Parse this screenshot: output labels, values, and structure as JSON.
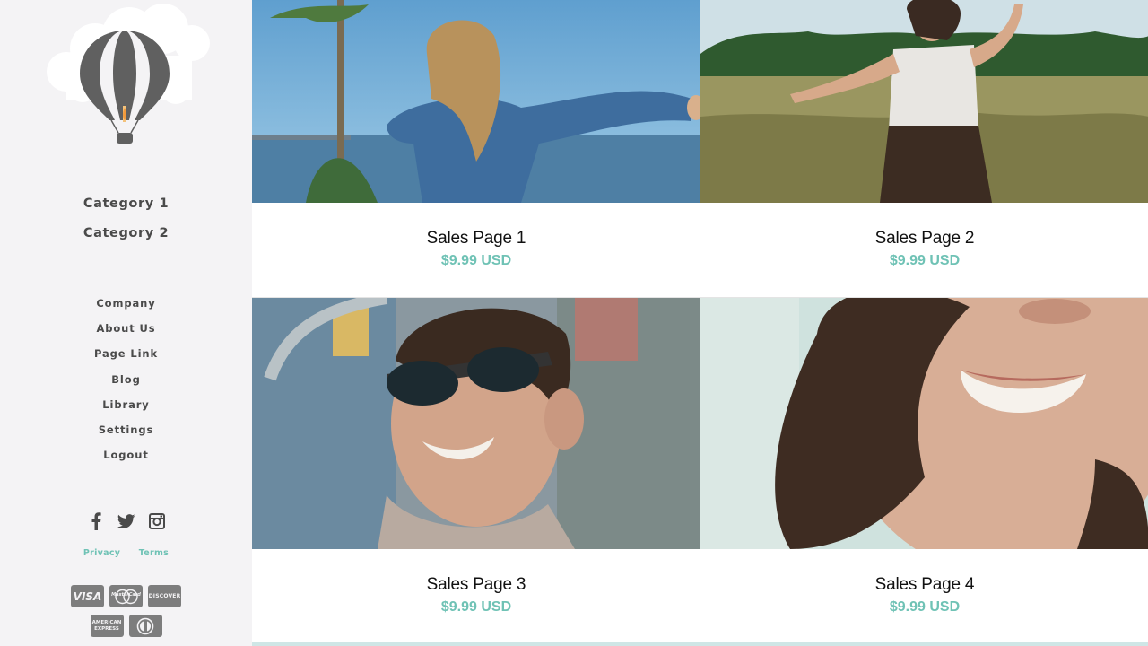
{
  "sidebar": {
    "categories": [
      {
        "label": "Category 1"
      },
      {
        "label": "Category 2"
      }
    ],
    "nav": [
      {
        "label": "Company"
      },
      {
        "label": "About Us"
      },
      {
        "label": "Page Link"
      },
      {
        "label": "Blog"
      },
      {
        "label": "Library"
      },
      {
        "label": "Settings"
      },
      {
        "label": "Logout"
      }
    ],
    "socials": [
      "facebook-icon",
      "twitter-icon",
      "instagram-icon"
    ],
    "legal": {
      "privacy": "Privacy",
      "terms": "Terms"
    },
    "payments": {
      "visa": "VISA",
      "mastercard": "MasterCard",
      "discover": "DISCOVER",
      "amex_line1": "AMERICAN",
      "amex_line2": "EXPRESS"
    }
  },
  "products": [
    {
      "title": "Sales Page 1",
      "price": "$9.99 USD"
    },
    {
      "title": "Sales Page 2",
      "price": "$9.99 USD"
    },
    {
      "title": "Sales Page 3",
      "price": "$9.99 USD"
    },
    {
      "title": "Sales Page 4",
      "price": "$9.99 USD"
    }
  ],
  "colors": {
    "accent": "#6fc2b5",
    "sidebar_bg": "#f4f3f5",
    "text": "#4a4a4a"
  }
}
